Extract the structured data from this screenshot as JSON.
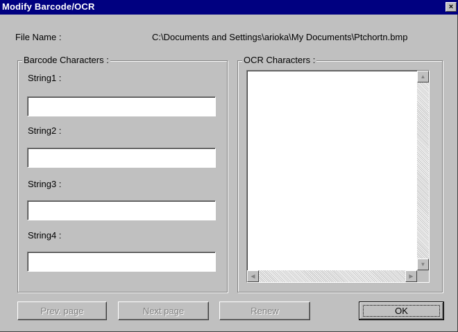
{
  "window": {
    "title": "Modify Barcode/OCR",
    "close_glyph": "×"
  },
  "file": {
    "label": "File Name :",
    "path": "C:\\Documents and Settings\\arioka\\My Documents\\Ptchortn.bmp"
  },
  "barcode": {
    "group_label": "Barcode Characters :",
    "strings": [
      {
        "label": "String1 :",
        "value": ""
      },
      {
        "label": "String2 :",
        "value": ""
      },
      {
        "label": "String3 :",
        "value": ""
      },
      {
        "label": "String4 :",
        "value": ""
      }
    ]
  },
  "ocr": {
    "group_label": "OCR Characters :",
    "value": ""
  },
  "buttons": {
    "prev": {
      "label": "Prev. page",
      "enabled": false
    },
    "next": {
      "label": "Next page",
      "enabled": false
    },
    "renew": {
      "label": "Renew",
      "enabled": false
    },
    "ok": {
      "label": "OK",
      "enabled": true
    }
  },
  "icons": {
    "scroll_up": "scroll-up-arrow-icon",
    "scroll_down": "scroll-down-arrow-icon",
    "scroll_left": "scroll-left-arrow-icon",
    "scroll_right": "scroll-right-arrow-icon"
  }
}
